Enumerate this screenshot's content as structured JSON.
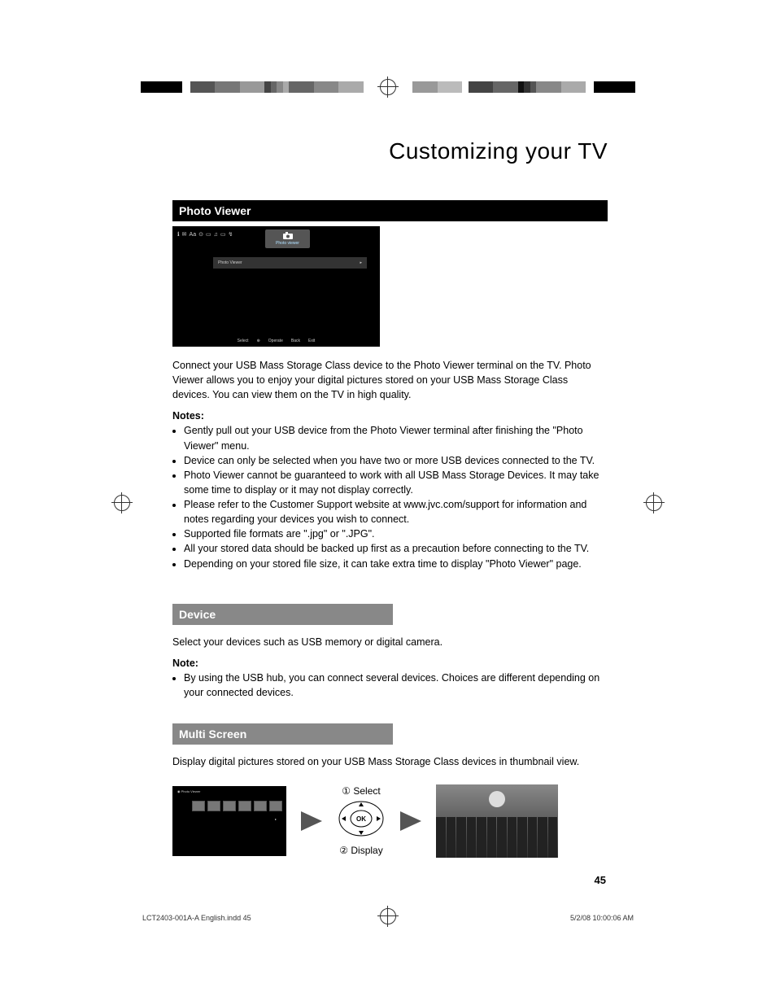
{
  "page_title": "Customizing your TV",
  "photo_viewer": {
    "heading": "Photo Viewer",
    "menu_tab_label": "Photo viewer",
    "menu_row_label": "Photo Viewer",
    "menu_bottom": {
      "select": "Select",
      "operate": "Operate",
      "back": "Back",
      "exit": "Exit"
    },
    "intro": "Connect your USB Mass Storage Class device to the Photo Viewer terminal on the TV.  Photo Viewer allows you to enjoy your digital pictures stored on your USB Mass Storage Class devices.  You can view them on the TV in high quality.",
    "notes_heading": "Notes:",
    "notes": [
      "Gently pull out your USB device from the Photo Viewer terminal after finishing the \"Photo Viewer\" menu.",
      "Device can only be selected when you have two or more USB devices connected to the TV.",
      "Photo Viewer cannot be guaranteed to work with all USB Mass Storage Devices.  It may take some time to display or it may not display correctly.",
      "Please refer to the Customer Support website at www.jvc.com/support for information and notes regarding your devices you wish to connect.",
      "Supported file formats are \".jpg\" or \".JPG\".",
      "All your stored data should be backed up first as a precaution before connecting to the TV.",
      "Depending on your stored file size, it can take extra time to display \"Photo Viewer\" page."
    ]
  },
  "device": {
    "heading": "Device",
    "text": "Select your devices such as USB memory or digital camera.",
    "note_heading": "Note:",
    "notes": [
      "By using the USB hub, you can connect several devices. Choices are different depending on your connected devices."
    ]
  },
  "multi_screen": {
    "heading": "Multi Screen",
    "text": "Display digital pictures stored on your USB Mass Storage Class devices in thumbnail view.",
    "step1": "① Select",
    "step2": "② Display",
    "ok_label": "OK"
  },
  "page_number": "45",
  "footer": {
    "left": "LCT2403-001A-A English.indd   45",
    "right": "5/2/08   10:00:06 AM"
  }
}
